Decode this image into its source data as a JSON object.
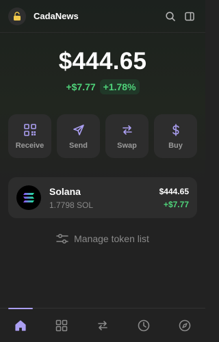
{
  "header": {
    "title": "CadaNews",
    "avatar_icon": "lock-icon",
    "search_icon": "search-icon",
    "sidebar_icon": "sidebar-panel-icon"
  },
  "balance": {
    "total": "$444.65",
    "change_amount": "+$7.77",
    "change_percent": "+1.78%"
  },
  "actions": [
    {
      "label": "Receive",
      "icon": "qr-code-icon"
    },
    {
      "label": "Send",
      "icon": "send-arrow-icon"
    },
    {
      "label": "Swap",
      "icon": "swap-icon"
    },
    {
      "label": "Buy",
      "icon": "dollar-icon"
    }
  ],
  "tokens": [
    {
      "name": "Solana",
      "amount": "1.7798 SOL",
      "value": "$444.65",
      "change": "+$7.77",
      "icon": "solana-logo-icon"
    }
  ],
  "manage": {
    "label": "Manage token list",
    "icon": "sliders-icon"
  },
  "nav": [
    {
      "name": "home",
      "icon": "home-icon",
      "active": true
    },
    {
      "name": "collectibles",
      "icon": "grid-icon",
      "active": false
    },
    {
      "name": "swap",
      "icon": "swap-icon",
      "active": false
    },
    {
      "name": "activity",
      "icon": "clock-icon",
      "active": false
    },
    {
      "name": "explore",
      "icon": "compass-icon",
      "active": false
    }
  ],
  "colors": {
    "accent": "#ab9ff2",
    "positive": "#4fd37a",
    "background": "#222222",
    "card": "#2d2d2d",
    "avatar_lock": "#f2c94c"
  }
}
